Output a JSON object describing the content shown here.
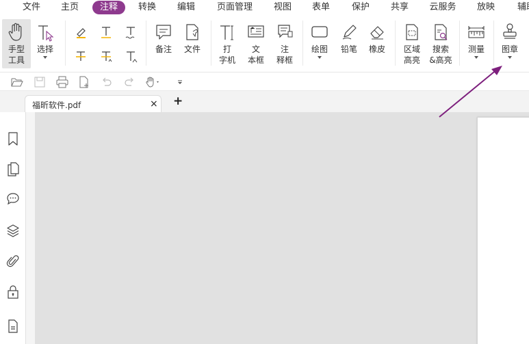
{
  "menu": {
    "items": [
      {
        "key": "file",
        "label": "文件"
      },
      {
        "key": "home",
        "label": "主页"
      },
      {
        "key": "comment",
        "label": "注释"
      },
      {
        "key": "convert",
        "label": "转换"
      },
      {
        "key": "edit",
        "label": "编辑"
      },
      {
        "key": "page_manage",
        "label": "页面管理"
      },
      {
        "key": "view",
        "label": "视图"
      },
      {
        "key": "forms",
        "label": "表单"
      },
      {
        "key": "protect",
        "label": "保护"
      },
      {
        "key": "share",
        "label": "共享"
      },
      {
        "key": "cloud",
        "label": "云服务"
      },
      {
        "key": "present",
        "label": "放映"
      },
      {
        "key": "assist",
        "label": "辅助"
      }
    ],
    "active": "注释"
  },
  "ribbon": {
    "hand_tool": "手型\n工具",
    "select": "选择",
    "note": "备注",
    "file": "文件",
    "typewriter": "打\n字机",
    "textbox": "文\n本框",
    "callout": "注\n释框",
    "drawing": "绘图",
    "pencil": "铅笔",
    "eraser": "橡皮",
    "area_highlight": "区域\n高亮",
    "search_highlight": "搜索\n&高亮",
    "measure": "测量",
    "stamp": "图章"
  },
  "tabs": {
    "document_name": "福昕软件.pdf",
    "close_symbol": "×",
    "new_tab_symbol": "+"
  },
  "colors": {
    "accent": "#8e3a8e",
    "arrow": "#7d1f7d",
    "canvas": "#e1e1e1",
    "highlighter": "#f5b400"
  }
}
